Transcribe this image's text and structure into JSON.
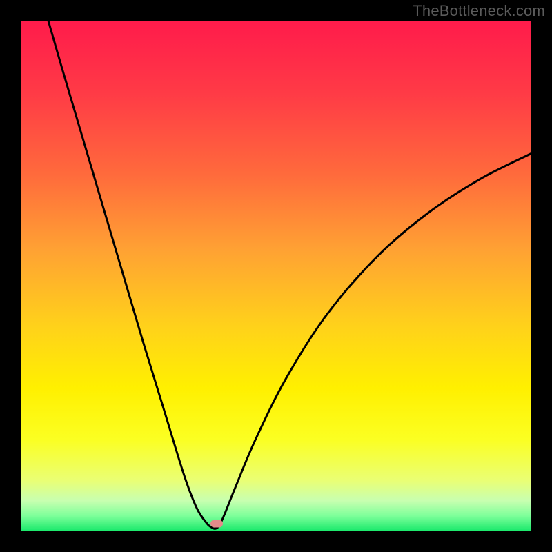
{
  "watermark": {
    "text": "TheBottleneck.com"
  },
  "plot": {
    "size": 740,
    "gradient_stops": [
      {
        "pct": 0,
        "color": "#ff1b4b"
      },
      {
        "pct": 14,
        "color": "#ff3a46"
      },
      {
        "pct": 30,
        "color": "#ff6a3c"
      },
      {
        "pct": 45,
        "color": "#ffa233"
      },
      {
        "pct": 60,
        "color": "#ffd21a"
      },
      {
        "pct": 72,
        "color": "#fff000"
      },
      {
        "pct": 82,
        "color": "#fbff22"
      },
      {
        "pct": 90,
        "color": "#eaff74"
      },
      {
        "pct": 94,
        "color": "#c8ffb0"
      },
      {
        "pct": 97,
        "color": "#7dff9a"
      },
      {
        "pct": 100,
        "color": "#17e86a"
      }
    ],
    "curve": {
      "stroke": "#000000",
      "stroke_width": 3
    },
    "marker": {
      "x_pct": 0.3835,
      "y_pct": 0.985,
      "color": "#e58b8b"
    }
  },
  "chart_data": {
    "type": "line",
    "title": "",
    "xlabel": "",
    "ylabel": "",
    "xlim": [
      0,
      100
    ],
    "ylim": [
      0,
      100
    ],
    "annotations": [
      "TheBottleneck.com"
    ],
    "series": [
      {
        "name": "bottleneck-curve",
        "x": [
          5.4,
          8,
          12,
          16,
          20,
          24,
          28,
          32,
          34.5,
          36.5,
          37.5,
          38,
          38.5,
          39,
          40,
          42,
          46,
          52,
          60,
          70,
          80,
          90,
          100
        ],
        "y": [
          100,
          91,
          77.5,
          64,
          50.5,
          37,
          24,
          11,
          4.5,
          1.5,
          0.7,
          0.5,
          0.7,
          1.3,
          3.5,
          8.5,
          18,
          30,
          42.5,
          54,
          62.5,
          69,
          74
        ]
      }
    ],
    "optimal_point": {
      "x": 38,
      "y": 0.5
    },
    "legend": false,
    "grid": false
  }
}
